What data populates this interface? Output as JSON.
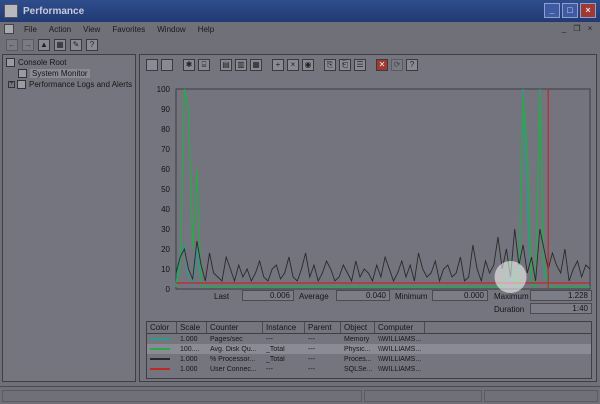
{
  "window": {
    "title": "Performance"
  },
  "menu": [
    "File",
    "Action",
    "View",
    "Favorites",
    "Window",
    "Help"
  ],
  "tree": {
    "root": "Console Root",
    "items": [
      "System Monitor",
      "Performance Logs and Alerts"
    ]
  },
  "chart_data": {
    "type": "line",
    "ylim": [
      0,
      100
    ],
    "y_ticks": [
      "100",
      "90",
      "80",
      "70",
      "60",
      "50",
      "40",
      "30",
      "20",
      "10",
      "0"
    ],
    "grid": false,
    "x": [
      0,
      1,
      2,
      3,
      4,
      5,
      6,
      7,
      8,
      9,
      10,
      11,
      12,
      13,
      14,
      15,
      16,
      17,
      18,
      19,
      20,
      21,
      22,
      23,
      24,
      25,
      26,
      27,
      28,
      29,
      30,
      31,
      32,
      33,
      34,
      35,
      36,
      37,
      38,
      39,
      40,
      41,
      42,
      43,
      44,
      45,
      46,
      47,
      48,
      49,
      50,
      51,
      52,
      53,
      54,
      55,
      56,
      57,
      58,
      59,
      60,
      61,
      62,
      63,
      64,
      65,
      66,
      67,
      68,
      69,
      70,
      71,
      72,
      73,
      74,
      75,
      76,
      77,
      78,
      79,
      80,
      81,
      82,
      83,
      84,
      85,
      86,
      87,
      88,
      89,
      90,
      91,
      92,
      93,
      94,
      95,
      96,
      97,
      98,
      99
    ],
    "series": [
      {
        "name": "Pages/sec",
        "color": "#2f9a8a",
        "values": [
          2,
          18,
          22,
          6,
          2,
          20,
          3,
          1,
          1,
          1,
          1,
          1,
          1,
          1,
          1,
          1,
          1,
          1,
          1,
          1,
          1,
          1,
          1,
          1,
          1,
          1,
          1,
          1,
          1,
          1,
          1,
          1,
          1,
          1,
          1,
          1,
          1,
          1,
          1,
          1,
          1,
          1,
          1,
          1,
          1,
          1,
          1,
          1,
          1,
          1,
          1,
          1,
          1,
          1,
          1,
          1,
          1,
          1,
          1,
          1,
          1,
          1,
          1,
          1,
          1,
          1,
          1,
          1,
          1,
          1,
          1,
          1,
          1,
          1,
          1,
          1,
          1,
          1,
          1,
          3,
          6,
          2,
          1,
          100,
          40,
          2,
          1,
          100,
          8,
          2,
          1,
          1,
          1,
          1,
          1,
          1,
          1,
          1,
          1,
          1
        ]
      },
      {
        "name": "Avg. Disk Qu...",
        "color": "#2aa84a",
        "values": [
          1,
          12,
          100,
          90,
          20,
          60,
          2,
          1,
          1,
          1,
          1,
          1,
          1,
          1,
          1,
          1,
          1,
          1,
          1,
          1,
          1,
          1,
          1,
          1,
          1,
          1,
          1,
          1,
          1,
          1,
          1,
          1,
          1,
          1,
          1,
          1,
          1,
          1,
          1,
          1,
          1,
          1,
          1,
          1,
          1,
          1,
          1,
          1,
          1,
          1,
          1,
          1,
          1,
          1,
          1,
          1,
          1,
          1,
          1,
          1,
          1,
          1,
          1,
          1,
          1,
          1,
          1,
          1,
          1,
          1,
          1,
          1,
          1,
          1,
          1,
          1,
          1,
          1,
          1,
          8,
          14,
          4,
          1,
          96,
          70,
          3,
          1,
          98,
          12,
          3,
          1,
          1,
          1,
          1,
          1,
          1,
          1,
          1,
          1,
          1
        ]
      },
      {
        "name": "% Processor...",
        "color": "#2a2a2a",
        "values": [
          8,
          16,
          20,
          10,
          5,
          24,
          12,
          4,
          18,
          8,
          6,
          4,
          16,
          10,
          4,
          12,
          6,
          10,
          4,
          8,
          14,
          6,
          4,
          10,
          12,
          5,
          8,
          16,
          6,
          4,
          10,
          18,
          6,
          12,
          4,
          8,
          14,
          10,
          4,
          6,
          12,
          8,
          4,
          14,
          6,
          10,
          8,
          4,
          12,
          6,
          16,
          10,
          4,
          8,
          14,
          6,
          12,
          4,
          18,
          10,
          6,
          8,
          14,
          4,
          10,
          12,
          6,
          8,
          16,
          4,
          6,
          22,
          10,
          4,
          14,
          8,
          12,
          26,
          10,
          20,
          6,
          30,
          12,
          22,
          8,
          16,
          4,
          30,
          20,
          10,
          18,
          12,
          8,
          20,
          4,
          10,
          14,
          6,
          12,
          10
        ]
      },
      {
        "name": "User Connec...",
        "color": "#c02828",
        "values": [
          3,
          3,
          3,
          3,
          3,
          3,
          3,
          3,
          3,
          3,
          3,
          3,
          3,
          3,
          3,
          3,
          3,
          3,
          3,
          3,
          3,
          3,
          3,
          3,
          3,
          3,
          3,
          3,
          3,
          3,
          3,
          3,
          3,
          3,
          3,
          3,
          3,
          3,
          3,
          3,
          3,
          3,
          3,
          3,
          3,
          3,
          3,
          3,
          3,
          3,
          3,
          3,
          3,
          3,
          3,
          3,
          3,
          3,
          3,
          3,
          3,
          3,
          3,
          3,
          3,
          3,
          3,
          3,
          3,
          3,
          3,
          3,
          3,
          3,
          3,
          3,
          3,
          3,
          3,
          3,
          3,
          3,
          3,
          3,
          3,
          3,
          3,
          3,
          3,
          3,
          3,
          3,
          3,
          3,
          3,
          3,
          3,
          3,
          3,
          3
        ]
      }
    ]
  },
  "stats": {
    "last_label": "Last",
    "last_value": "0.006",
    "average_label": "Average",
    "average_value": "0.040",
    "minimum_label": "Minimum",
    "minimum_value": "0.000",
    "maximum_label": "Maximum",
    "maximum_value": "1.228",
    "duration_label": "Duration",
    "duration_value": "1:40"
  },
  "legend": {
    "headers": [
      "Color",
      "Scale",
      "Counter",
      "Instance",
      "Parent",
      "Object",
      "Computer"
    ],
    "rows": [
      {
        "color": "#2f9a8a",
        "scale": "1.000",
        "counter": "Pages/sec",
        "instance": "---",
        "parent": "---",
        "object": "Memory",
        "computer": "\\\\WILLIAMS..."
      },
      {
        "color": "#2aa84a",
        "scale": "100....",
        "counter": "Avg. Disk Qu...",
        "instance": "_Total",
        "parent": "---",
        "object": "Physic...",
        "computer": "\\\\WILLIAMS..."
      },
      {
        "color": "#2a2a2a",
        "scale": "1.000",
        "counter": "% Processor...",
        "instance": "_Total",
        "parent": "---",
        "object": "Proces...",
        "computer": "\\\\WILLIAMS..."
      },
      {
        "color": "#c02828",
        "scale": "1.000",
        "counter": "User Connec...",
        "instance": "---",
        "parent": "---",
        "object": "SQLSe...",
        "computer": "\\\\WILLIAMS..."
      }
    ]
  }
}
